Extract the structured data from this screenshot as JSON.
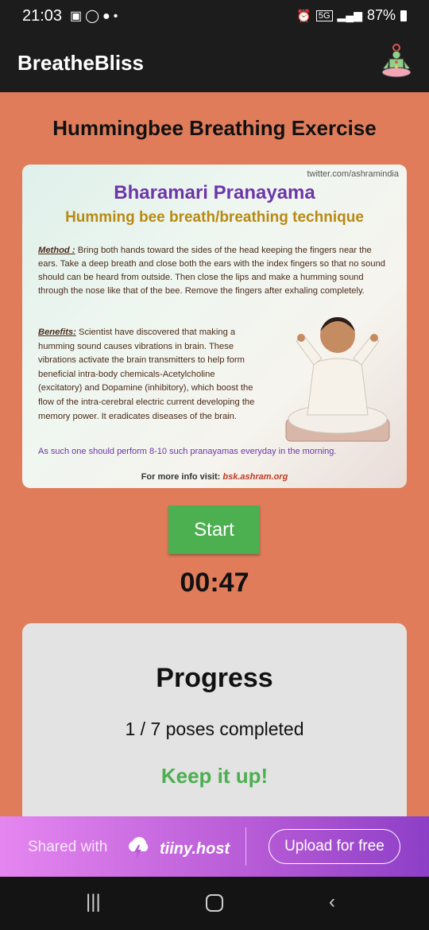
{
  "status_bar": {
    "time": "21:03",
    "battery": "87%",
    "network": "5G"
  },
  "app_bar": {
    "title": "BreatheBliss",
    "logo_icon": "meditation-logo-icon"
  },
  "exercise": {
    "title": "Hummingbee Breathing Exercise"
  },
  "image": {
    "source": "twitter.com/ashramindia",
    "heading": "Bharamari Pranayama",
    "subheading": "Humming bee breath/breathing technique",
    "method_label": "Method :",
    "method_text": "Bring both hands toward the sides of the head keeping the fingers near the ears. Take a deep breath and close both the ears with the index fingers so that no sound should can be heard from outside. Then close the lips and make a humming sound through the nose like that of the bee. Remove the fingers after exhaling completely.",
    "benefits_label": "Benefits:",
    "benefits_text": "Scientist have discovered that making a humming sound causes vibrations in brain. These vibrations activate the brain transmitters to help form beneficial intra-body chemicals-Acetylcholine (excitatory) and Dopamine (inhibitory), which boost the flow of the intra-cerebral electric current developing the memory power. It eradicates diseases of the brain.",
    "advice": "As such one should perform 8-10 such pranayamas everyday in the morning.",
    "more_info_label": "For more info visit:",
    "more_info_link": "bsk.ashram.org"
  },
  "controls": {
    "start_label": "Start",
    "timer": "00:47"
  },
  "progress": {
    "title": "Progress",
    "completed_text": "1 / 7 poses completed",
    "encouragement": "Keep it up!",
    "completed": 1,
    "total": 7
  },
  "banner": {
    "shared_label": "Shared with",
    "host_name": "tiiny.host",
    "upload_label": "Upload for free"
  },
  "nav": {
    "recents_icon": "recents-icon",
    "home_icon": "home-icon",
    "back_icon": "back-icon"
  },
  "colors": {
    "background": "#e07c5a",
    "app_bar": "#1c1c1c",
    "accent_green": "#4caf50",
    "card": "#e3e3e3"
  }
}
